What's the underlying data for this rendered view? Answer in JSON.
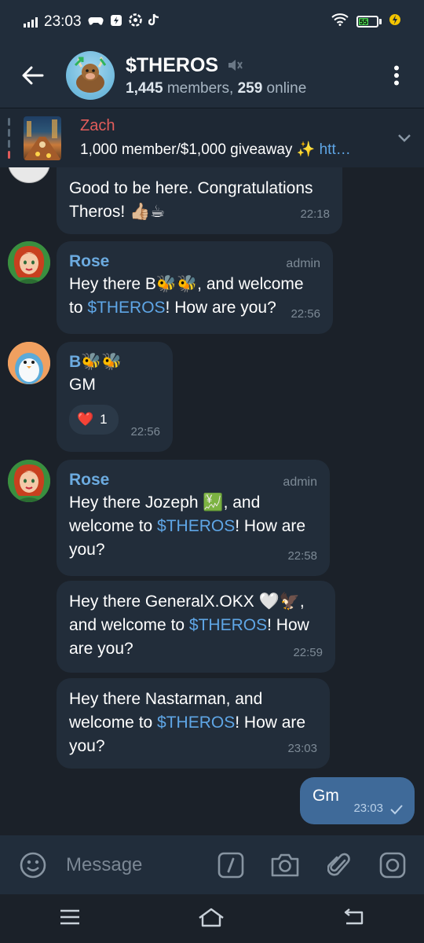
{
  "status_bar": {
    "time": "23:03",
    "battery_level": "55",
    "battery_fraction": 0.55
  },
  "header": {
    "title": "$THEROS",
    "members": "1,445",
    "members_suffix": " members, ",
    "online": "259",
    "online_suffix": " online"
  },
  "pinned": {
    "sender": "Zach",
    "text": "1,000 member/$1,000 giveaway ✨ ",
    "link_fragment": "htt…"
  },
  "messages": [
    {
      "text_line1": "Good to be here. Congratulations",
      "text_line2": "Theros! 👍🏼☕",
      "time": "22:18"
    },
    {
      "sender": "Rose",
      "badge": "admin",
      "text_a": "Hey there B🐝🐝, and welcome",
      "text_b_pre": "to ",
      "text_b_link": "$THEROS",
      "text_b_post": "! How are you?",
      "time": "22:56"
    },
    {
      "sender": "B🐝🐝",
      "text": "GM",
      "reaction_emoji": "❤️",
      "reaction_count": "1",
      "time": "22:56"
    },
    {
      "sender": "Rose",
      "badge": "admin",
      "text_a": "Hey there Jozeph 💹, and",
      "text_b_pre": "welcome to ",
      "text_b_link": "$THEROS",
      "text_b_post": "! How are",
      "text_c": "you?",
      "time": "22:58"
    },
    {
      "text_a": "Hey there GeneralX.OKX 🤍🦅,",
      "text_b_pre": "and welcome to ",
      "text_b_link": "$THEROS",
      "text_b_post": "! How",
      "text_c": "are you?",
      "time": "22:59"
    },
    {
      "text_a": "Hey there Nastarman, and",
      "text_b_pre": "welcome to ",
      "text_b_link": "$THEROS",
      "text_b_post": "! How are",
      "text_c": "you?",
      "time": "23:03"
    },
    {
      "text": "Gm",
      "time": "23:03",
      "outgoing": true
    }
  ],
  "input": {
    "placeholder": "Message"
  },
  "colors": {
    "background": "#1b2129",
    "header": "#212d3b",
    "bubble_in": "#222d3a",
    "bubble_out": "#3f6a99",
    "link": "#5fa6e6",
    "pinned_name": "#e35d5b"
  }
}
